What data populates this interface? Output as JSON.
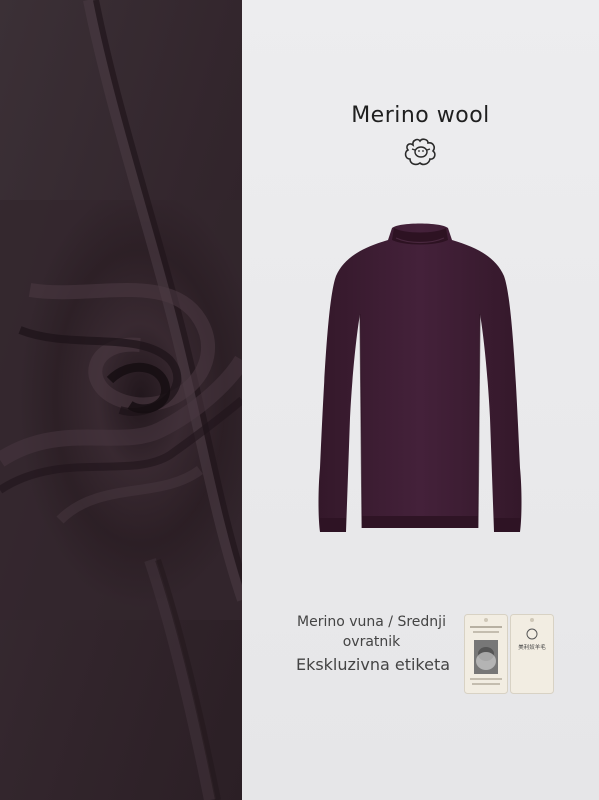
{
  "header": {
    "title": "Merino wool"
  },
  "icons": {
    "brand": "sheep-icon"
  },
  "product": {
    "name": "purple-mock-neck-sweater",
    "color": "#3b1d2b"
  },
  "fabric": {
    "color": "#3a2a31"
  },
  "caption": {
    "line1": "Merino vuna / Srednji ovratnik",
    "line2": "Ekskluzivna etiketa"
  },
  "tags": {
    "right_tag_text": "美利奴羊毛"
  }
}
